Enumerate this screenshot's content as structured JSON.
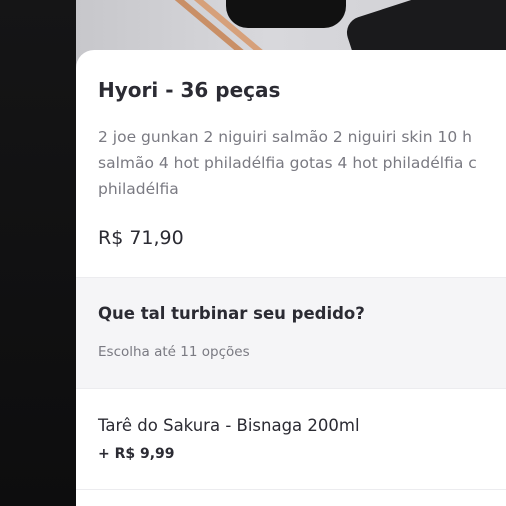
{
  "product": {
    "title": "Hyori - 36 peças",
    "description_lines": [
      "2 joe gunkan  2 niguiri salmão 2 niguiri skin 10 h",
      "salmão 4 hot philadélfia gotas 4 hot philadélfia c",
      "philadélfia"
    ],
    "price": "R$ 71,90"
  },
  "addons": {
    "title": "Que tal turbinar seu pedido?",
    "subtitle": "Escolha até 11 opções",
    "items": [
      {
        "name": "Tarê do Sakura - Bisnaga 200ml",
        "price": "+ R$ 9,99"
      }
    ]
  }
}
